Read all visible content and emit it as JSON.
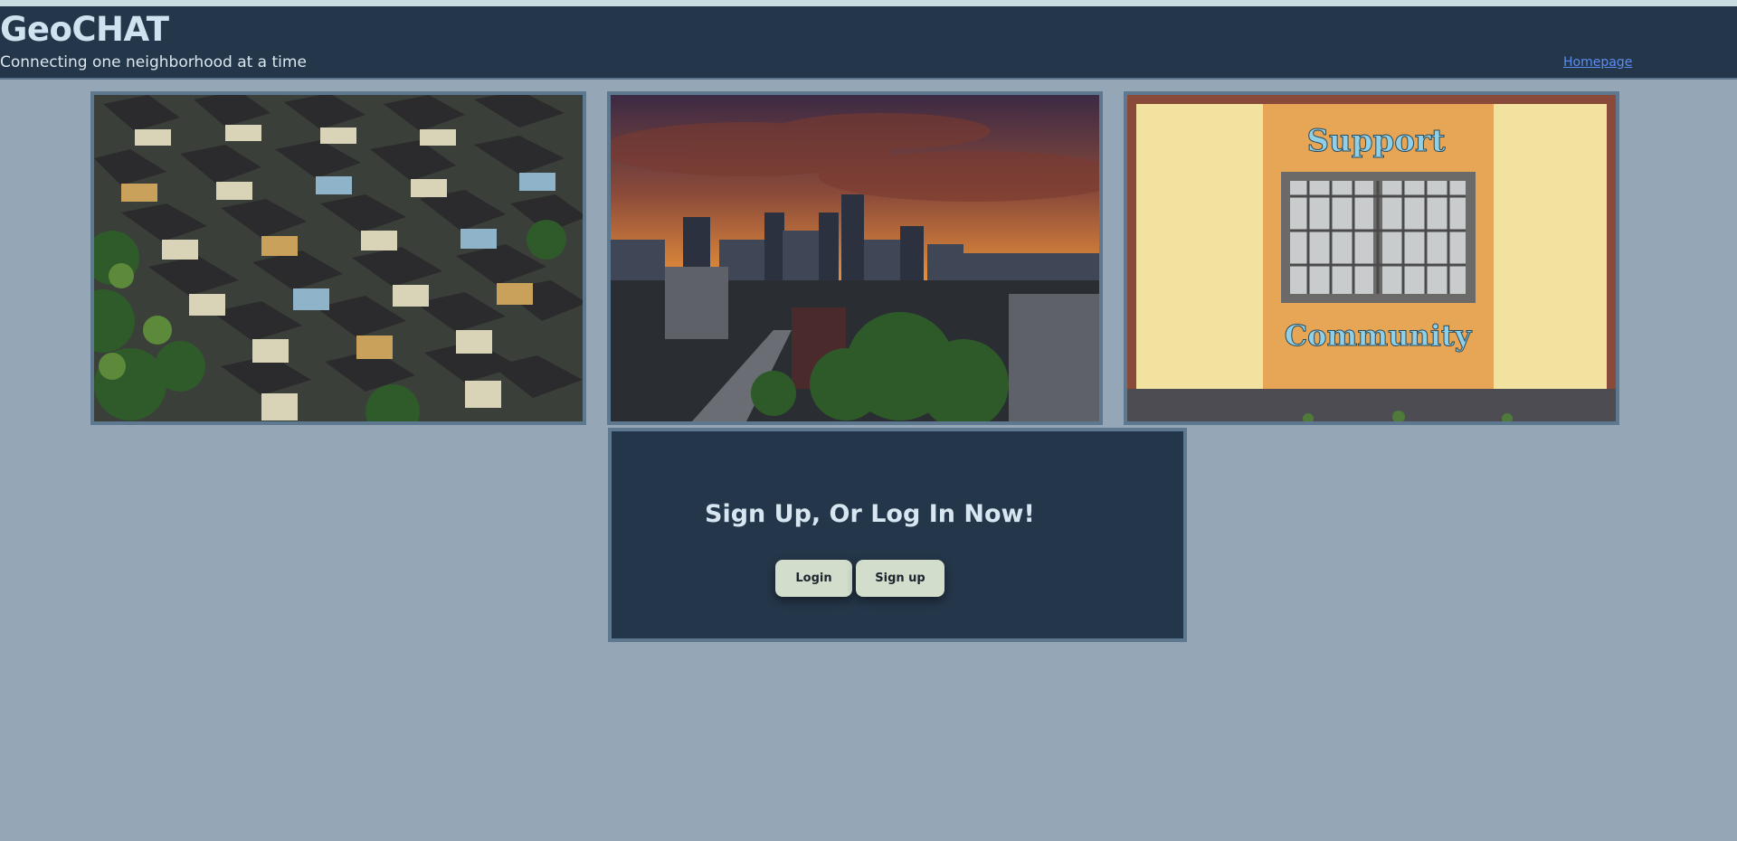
{
  "header": {
    "title": "GeoCHAT",
    "tagline": "Connecting one neighborhood at a time",
    "home_link": "Homepage"
  },
  "gallery": {
    "images": [
      {
        "subject": "aerial-houses-neighborhood"
      },
      {
        "subject": "city-skyline-sunset"
      },
      {
        "subject": "support-community-wall",
        "sign_top": "Support",
        "sign_bottom": "Community"
      }
    ]
  },
  "cta": {
    "heading": "Sign Up, Or Log In Now!",
    "login_label": "Login",
    "signup_label": "Sign up"
  },
  "colors": {
    "background": "#95a7b6",
    "header": "#243649",
    "panel": "#243649",
    "border": "#5e7890",
    "button": "#d2ddcc",
    "link": "#5c8cf0"
  }
}
